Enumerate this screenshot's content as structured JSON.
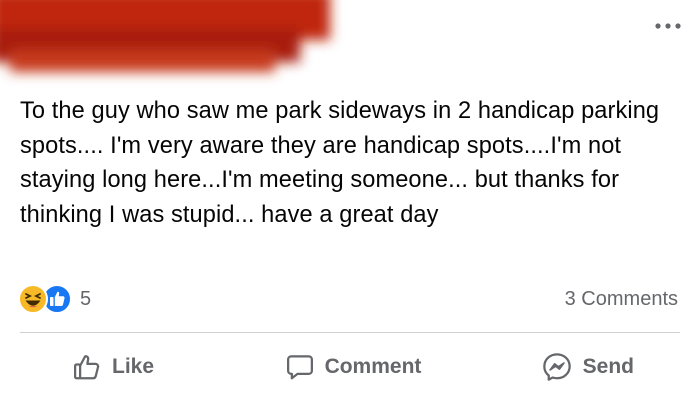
{
  "post": {
    "author_redacted": true,
    "text": "To the guy who saw me park sideways in 2 handicap parking spots.... I'm very aware they are handicap spots....I'm not staying long here...I'm meeting someone... but thanks for thinking I was stupid... have a great day"
  },
  "reactions": {
    "count": "5",
    "types": [
      "haha-emoji-icon",
      "like-icon"
    ]
  },
  "comments": {
    "label": "3 Comments"
  },
  "actions": {
    "like_label": "Like",
    "comment_label": "Comment",
    "send_label": "Send"
  },
  "colors": {
    "redaction": "#b8210f",
    "secondary_text": "#65676b",
    "like_blue": "#1877f2",
    "haha_yellow": "#f7b928"
  }
}
